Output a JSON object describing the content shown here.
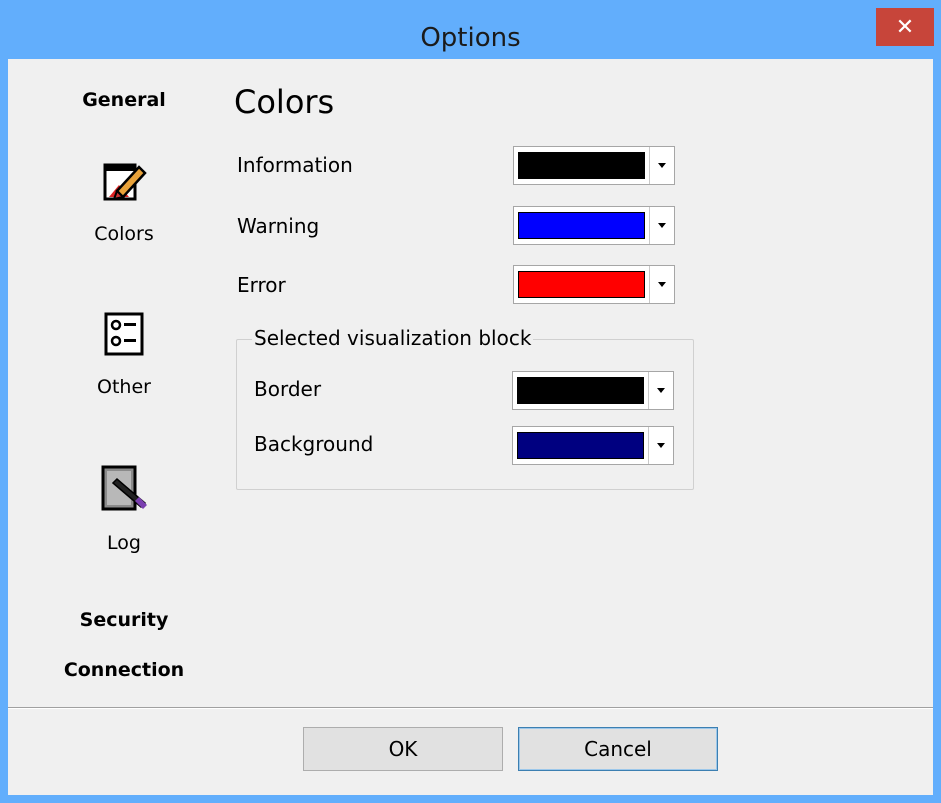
{
  "window": {
    "title": "Options",
    "close_label": "✕"
  },
  "sidebar": {
    "categories": [
      "General",
      "Security",
      "Connection"
    ],
    "items": [
      {
        "label": "Colors",
        "icon": "palette-icon"
      },
      {
        "label": "Other",
        "icon": "list-options-icon"
      },
      {
        "label": "Log",
        "icon": "log-book-icon"
      }
    ]
  },
  "panel": {
    "title": "Colors",
    "rows": [
      {
        "label": "Information",
        "color": "#000000"
      },
      {
        "label": "Warning",
        "color": "#0000ff"
      },
      {
        "label": "Error",
        "color": "#ff0000"
      }
    ],
    "group": {
      "label": "Selected visualization block",
      "rows": [
        {
          "label": "Border",
          "color": "#000000"
        },
        {
          "label": "Background",
          "color": "#000080"
        }
      ]
    }
  },
  "buttons": {
    "ok": "OK",
    "cancel": "Cancel"
  }
}
